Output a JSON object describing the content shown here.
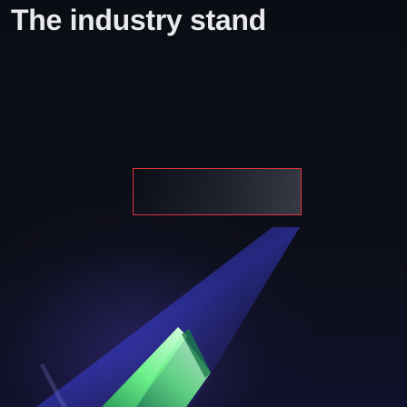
{
  "hero": {
    "headline": "The industry stand"
  },
  "colors": {
    "background": "#0b0d14",
    "headline_text": "#e9eaee",
    "cta_border": "#e0313f",
    "art_green": "#6cf08a",
    "art_blue": "#3a3fd8"
  },
  "icons": {
    "hero_art": "green-gradient-shape-icon"
  }
}
